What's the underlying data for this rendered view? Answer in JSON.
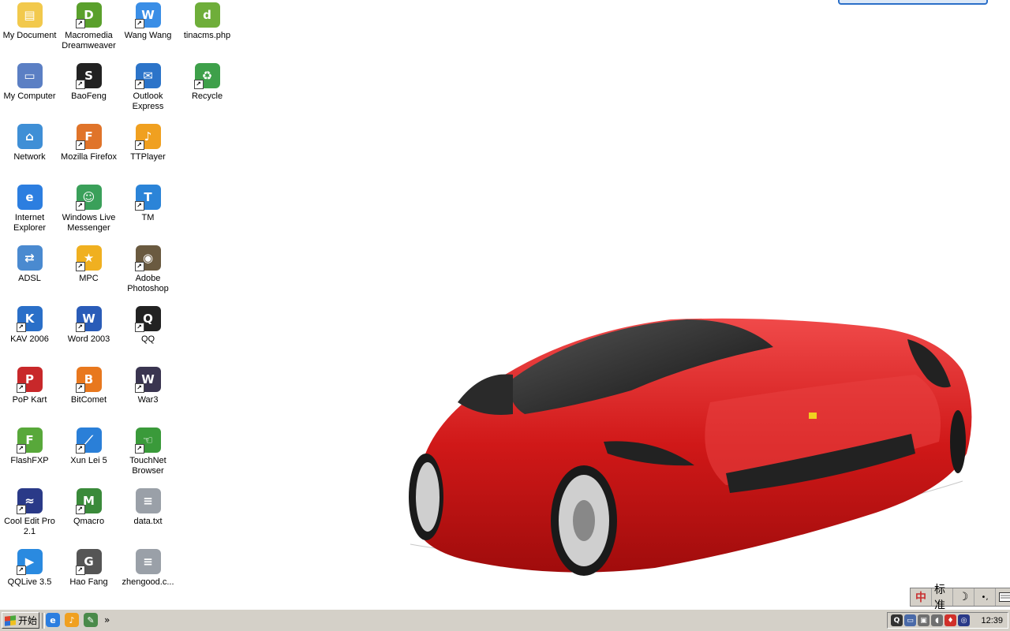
{
  "desktop": {
    "icons": [
      {
        "label": "My Document",
        "symbol": "▤",
        "color": "#f2c94c",
        "shortcut": false,
        "icon": "folder-document-icon"
      },
      {
        "label": "Macromedia Dreamweaver",
        "symbol": "D",
        "color": "#5aa02c",
        "shortcut": true,
        "icon": "dreamweaver-icon"
      },
      {
        "label": "Wang Wang",
        "symbol": "W",
        "color": "#3a8ee6",
        "shortcut": true,
        "icon": "wangwang-icon"
      },
      {
        "label": "tinacms.php",
        "symbol": "d",
        "color": "#6fae3a",
        "shortcut": false,
        "icon": "php-file-icon"
      },
      {
        "label": "My Computer",
        "symbol": "▭",
        "color": "#5b7fc4",
        "shortcut": false,
        "icon": "my-computer-icon"
      },
      {
        "label": "BaoFeng",
        "symbol": "S",
        "color": "#222222",
        "shortcut": true,
        "icon": "baofeng-icon"
      },
      {
        "label": "Outlook Express",
        "symbol": "✉",
        "color": "#2c74c9",
        "shortcut": true,
        "icon": "outlook-express-icon"
      },
      {
        "label": "Recycle",
        "symbol": "♻",
        "color": "#3ea04a",
        "shortcut": true,
        "icon": "recycle-icon"
      },
      {
        "label": "Network",
        "symbol": "⌂",
        "color": "#3f8fd6",
        "shortcut": false,
        "icon": "network-icon"
      },
      {
        "label": "Mozilla Firefox",
        "symbol": "F",
        "color": "#e0742a",
        "shortcut": true,
        "icon": "firefox-icon"
      },
      {
        "label": "TTPlayer",
        "symbol": "♪",
        "color": "#f0a020",
        "shortcut": true,
        "icon": "ttplayer-icon"
      },
      null,
      {
        "label": "Internet Explorer",
        "symbol": "e",
        "color": "#2c7ee0",
        "shortcut": false,
        "icon": "internet-explorer-icon"
      },
      {
        "label": "Windows Live Messenger",
        "symbol": "☺",
        "color": "#3aa05a",
        "shortcut": true,
        "icon": "messenger-icon"
      },
      {
        "label": "TM",
        "symbol": "T",
        "color": "#2b84d8",
        "shortcut": true,
        "icon": "tm-icon"
      },
      null,
      {
        "label": "ADSL",
        "symbol": "⇄",
        "color": "#4a8ad0",
        "shortcut": false,
        "icon": "adsl-icon"
      },
      {
        "label": "MPC",
        "symbol": "★",
        "color": "#f0b020",
        "shortcut": true,
        "icon": "mpc-icon"
      },
      {
        "label": "Adobe Photoshop",
        "symbol": "◉",
        "color": "#6a5a40",
        "shortcut": true,
        "icon": "photoshop-icon"
      },
      null,
      {
        "label": "KAV 2006",
        "symbol": "K",
        "color": "#2a6fc8",
        "shortcut": true,
        "icon": "kav-icon"
      },
      {
        "label": "Word 2003",
        "symbol": "W",
        "color": "#2a5cb8",
        "shortcut": true,
        "icon": "word-icon"
      },
      {
        "label": "QQ",
        "symbol": "Q",
        "color": "#222222",
        "shortcut": true,
        "icon": "qq-icon"
      },
      null,
      {
        "label": "PoP Kart",
        "symbol": "P",
        "color": "#c8282a",
        "shortcut": true,
        "icon": "popkart-icon"
      },
      {
        "label": "BitComet",
        "symbol": "B",
        "color": "#e8781e",
        "shortcut": true,
        "icon": "bitcomet-icon"
      },
      {
        "label": "War3",
        "symbol": "W",
        "color": "#3a3550",
        "shortcut": true,
        "icon": "war3-icon"
      },
      null,
      {
        "label": "FlashFXP",
        "symbol": "F",
        "color": "#58a83a",
        "shortcut": true,
        "icon": "flashfxp-icon"
      },
      {
        "label": "Xun Lei 5",
        "symbol": "⟋",
        "color": "#2a7fd8",
        "shortcut": true,
        "icon": "xunlei-icon"
      },
      {
        "label": "TouchNet Browser",
        "symbol": "☜",
        "color": "#3a9a3a",
        "shortcut": true,
        "icon": "touchnet-icon"
      },
      null,
      {
        "label": "Cool Edit Pro 2.1",
        "symbol": "≈",
        "color": "#2a3a88",
        "shortcut": true,
        "icon": "cooledit-icon"
      },
      {
        "label": "Qmacro",
        "symbol": "M",
        "color": "#3a8a3a",
        "shortcut": true,
        "icon": "qmacro-icon"
      },
      {
        "label": "data.txt",
        "symbol": "≡",
        "color": "#9aa0a8",
        "shortcut": false,
        "icon": "text-file-icon"
      },
      null,
      {
        "label": "QQLive 3.5",
        "symbol": "▶",
        "color": "#2a8ae0",
        "shortcut": true,
        "icon": "qqlive-icon"
      },
      {
        "label": "Hao Fang",
        "symbol": "G",
        "color": "#555555",
        "shortcut": true,
        "icon": "haofang-icon"
      },
      {
        "label": "zhengood.c...",
        "symbol": "≡",
        "color": "#9aa0a8",
        "shortcut": false,
        "icon": "text-file-icon"
      },
      null
    ],
    "shortcut_arrow": "↗"
  },
  "ime_bar": {
    "logo_icon": "ime-logo-icon",
    "mode_label": "标准",
    "moon_symbol": "☽",
    "punct_symbol": "•,",
    "keyboard_icon": "keyboard-icon"
  },
  "taskbar": {
    "start_label": "开始",
    "quick_launch": [
      {
        "icon": "internet-explorer-icon",
        "symbol": "e",
        "color": "#2c7ee0"
      },
      {
        "icon": "ttplayer-icon",
        "symbol": "♪",
        "color": "#f0a020"
      },
      {
        "icon": "tool-icon",
        "symbol": "✎",
        "color": "#4a8a4a"
      }
    ],
    "more_label": "»",
    "tray_icons": [
      {
        "icon": "qq-tray-icon",
        "symbol": "Q",
        "color": "#333333"
      },
      {
        "icon": "network-tray-icon",
        "symbol": "▭",
        "color": "#4a6aa8"
      },
      {
        "icon": "monitor-tray-icon",
        "symbol": "▣",
        "color": "#707070"
      },
      {
        "icon": "speaker-tray-icon",
        "symbol": "◖",
        "color": "#707070"
      },
      {
        "icon": "shield-tray-icon",
        "symbol": "♦",
        "color": "#d0302a"
      },
      {
        "icon": "antivirus-tray-icon",
        "symbol": "◎",
        "color": "#2a3a88"
      }
    ],
    "clock": "12:39"
  }
}
